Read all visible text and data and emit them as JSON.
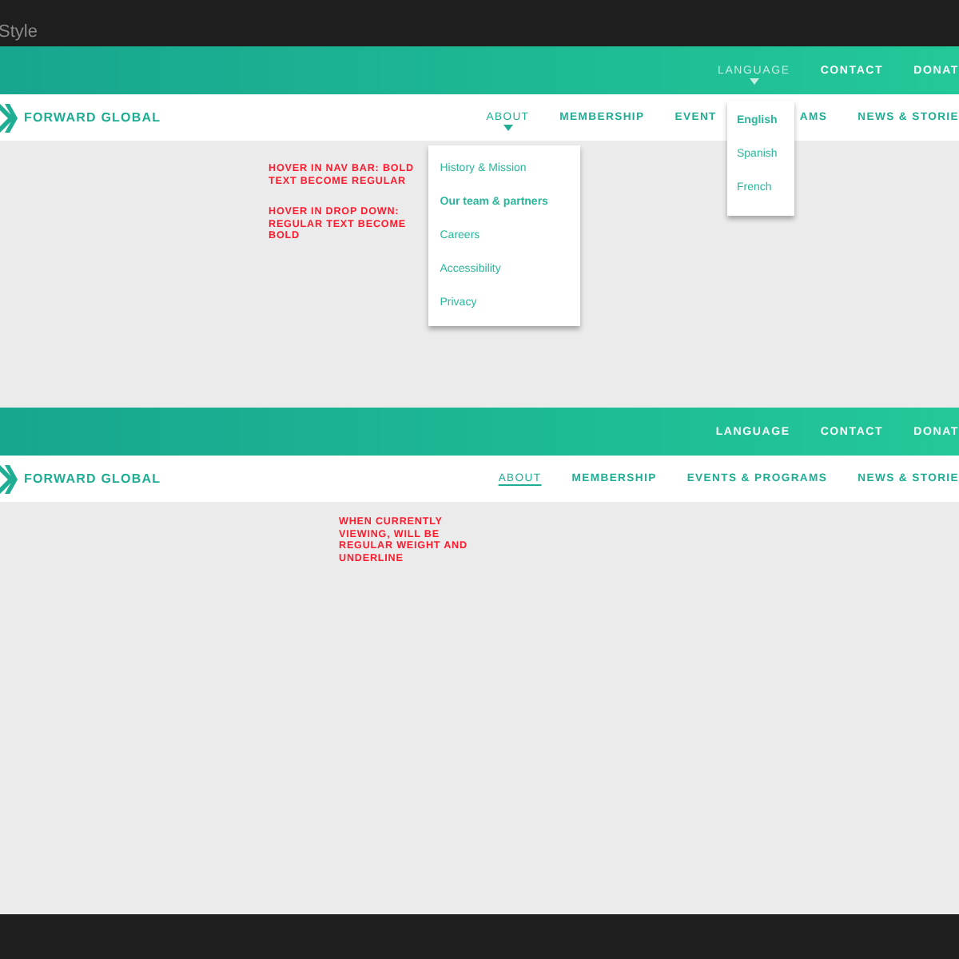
{
  "header": {
    "title": "Style"
  },
  "mockups": [
    {
      "utility_links": [
        {
          "label": "LANGUAGE",
          "hovered": true,
          "menu": [
            {
              "label": "English",
              "hovered": true
            },
            {
              "label": "Spanish",
              "hovered": false
            },
            {
              "label": "French",
              "hovered": false
            }
          ]
        },
        {
          "label": "CONTACT",
          "hovered": false
        },
        {
          "label": "DONAT",
          "hovered": false
        }
      ],
      "logo": "FORWARD GLOBAL",
      "nav": [
        {
          "label": "ABOUT",
          "hovered": true,
          "current": false,
          "menu": [
            {
              "label": "History & Mission",
              "hovered": false
            },
            {
              "label": "Our team & partners",
              "hovered": true
            },
            {
              "label": "Careers",
              "hovered": false
            },
            {
              "label": "Accessibility",
              "hovered": false
            },
            {
              "label": "Privacy",
              "hovered": false
            }
          ]
        },
        {
          "label": "MEMBERSHIP",
          "hovered": false,
          "current": false
        },
        {
          "label": "EVENT",
          "label_end": "AMS",
          "hovered": false,
          "current": false
        },
        {
          "label": "NEWS & STORIE",
          "hovered": false,
          "current": false
        }
      ],
      "notes": [
        "HOVER IN NAV BAR: BOLD TEXT BECOME REGULAR",
        "HOVER IN DROP DOWN: REGULAR TEXT BECOME BOLD"
      ]
    },
    {
      "utility_links": [
        {
          "label": "LANGUAGE",
          "hovered": false
        },
        {
          "label": "CONTACT",
          "hovered": false
        },
        {
          "label": "DONAT",
          "hovered": false
        }
      ],
      "logo": "FORWARD GLOBAL",
      "nav": [
        {
          "label": "ABOUT",
          "hovered": false,
          "current": true
        },
        {
          "label": "MEMBERSHIP",
          "hovered": false,
          "current": false
        },
        {
          "label": "EVENTS & PROGRAMS",
          "hovered": false,
          "current": false
        },
        {
          "label": "NEWS & STORIE",
          "hovered": false,
          "current": false
        }
      ],
      "notes": [
        "WHEN CURRENTLY VIEWING, WILL BE REGULAR WEIGHT AND UNDERLINE"
      ]
    }
  ]
}
